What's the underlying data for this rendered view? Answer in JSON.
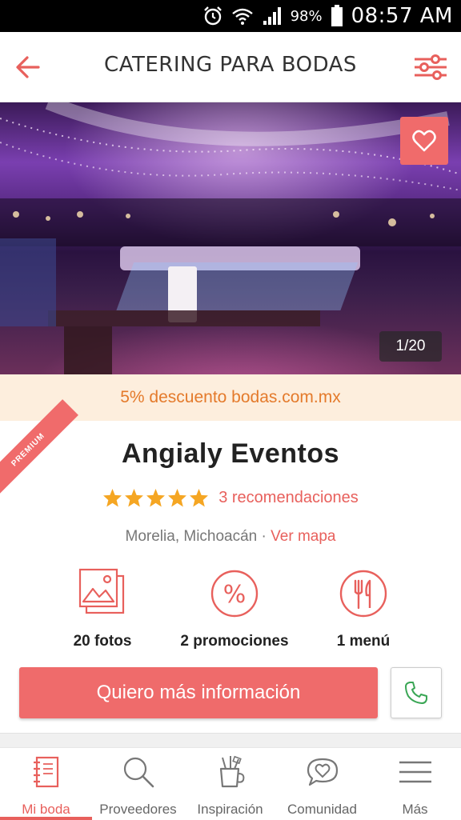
{
  "status_bar": {
    "battery_percent": "98%",
    "time": "08:57 AM",
    "icons": [
      "alarm-icon",
      "wifi-icon",
      "signal-icon",
      "battery-icon"
    ]
  },
  "app_bar": {
    "title": "CATERING PARA BODAS",
    "back_icon": "back-arrow-icon",
    "filter_icon": "filter-sliders-icon"
  },
  "gallery": {
    "counter": "1/20"
  },
  "promo": {
    "text": "5% descuento bodas.com.mx"
  },
  "vendor": {
    "badge": "PREMIUM",
    "name": "Angialy Eventos",
    "rating_stars": 5,
    "reviews": "3 recomendaciones",
    "location": "Morelia, Michoacán",
    "separator": " · ",
    "map_link": "Ver mapa"
  },
  "features": [
    {
      "icon": "photos-icon",
      "label": "20 fotos"
    },
    {
      "icon": "percent-icon",
      "label": "2 promociones"
    },
    {
      "icon": "menu-cutlery-icon",
      "label": "1 menú"
    }
  ],
  "cta": {
    "label": "Quiero más información"
  },
  "bottom_nav": [
    {
      "icon": "notebook-icon",
      "label": "Mi boda",
      "active": true
    },
    {
      "icon": "search-icon",
      "label": "Proveedores",
      "active": false
    },
    {
      "icon": "inspiration-icon",
      "label": "Inspiración",
      "active": false
    },
    {
      "icon": "chat-heart-icon",
      "label": "Comunidad",
      "active": false
    },
    {
      "icon": "hamburger-menu-icon",
      "label": "Más",
      "active": false
    }
  ],
  "colors": {
    "accent": "#ef6b6b",
    "promo_text": "#e47a2b",
    "promo_bg": "#fdeedd",
    "star": "#f5a623",
    "phone_icon": "#3aa655"
  }
}
